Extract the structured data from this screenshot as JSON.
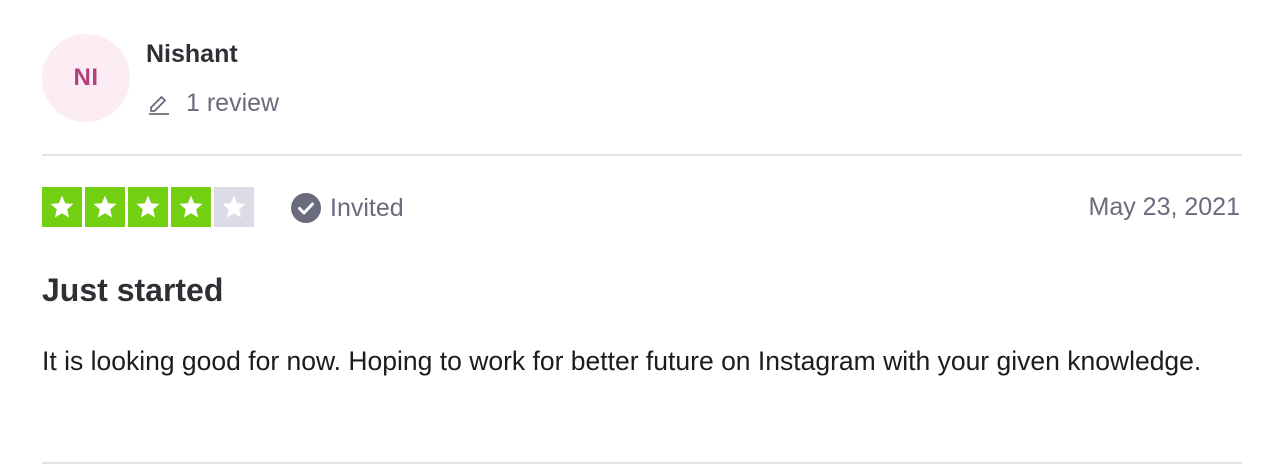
{
  "reviewer": {
    "initials": "NI",
    "name": "Nishant",
    "review_count_text": "1 review"
  },
  "rating": {
    "stars": 4,
    "max_stars": 5,
    "filled_color": "#73cf11",
    "empty_color": "#dcdce6"
  },
  "status": {
    "label": "Invited",
    "icon": "check-circle-icon"
  },
  "date": "May 23, 2021",
  "review": {
    "title": "Just started",
    "body": "It is looking good for now. Hoping to work for better future on Instagram with your given knowledge."
  },
  "colors": {
    "avatar_bg": "#fcecf4",
    "avatar_text": "#b3407c",
    "muted_text": "#6b6b7e",
    "divider": "#e3e3e6"
  },
  "icons": {
    "review_count": "pencil-icon",
    "star": "star-icon"
  }
}
